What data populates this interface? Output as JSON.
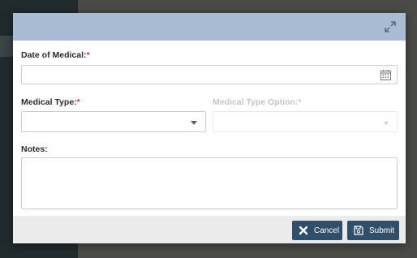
{
  "form": {
    "date_label": "Date of Medical:",
    "date_required": "*",
    "date_value": "",
    "type_label": "Medical Type:",
    "type_required": "*",
    "type_value": "",
    "option_label": "Medical Type Option:",
    "option_required": "*",
    "option_value": "",
    "notes_label": "Notes:",
    "notes_value": ""
  },
  "buttons": {
    "cancel_label": "Cancel",
    "submit_label": "Submit"
  },
  "colors": {
    "header": "#a9bcd3",
    "button": "#2f4f69",
    "required": "#d23a3a"
  },
  "icons": {
    "header": "expand-icon",
    "date": "calendar-icon",
    "cancel": "close-x-icon",
    "submit": "save-icon"
  }
}
